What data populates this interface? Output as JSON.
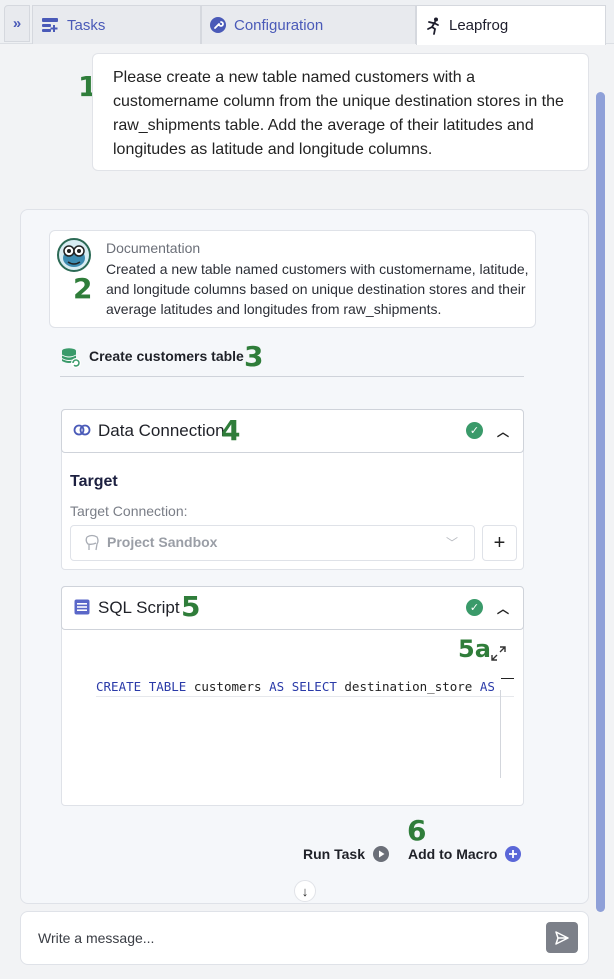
{
  "tabs": {
    "collapse_icon": "double-chevron-right-icon",
    "items": [
      {
        "label": "Tasks",
        "icon": "tasks-icon"
      },
      {
        "label": "Configuration",
        "icon": "wrench-icon"
      },
      {
        "label": "Leapfrog",
        "icon": "runner-icon",
        "active": true
      }
    ]
  },
  "annotations": {
    "a1": "1",
    "a2": "2",
    "a3": "3",
    "a4": "4",
    "a5": "5",
    "a5a": "5a",
    "a6": "6"
  },
  "prompt": {
    "text": "Please create a new table named customers with a customername column from the unique destination stores in the raw_shipments table. Add the average of their latitudes and longitudes as latitude and longitude columns."
  },
  "documentation": {
    "title": "Documentation",
    "text": "Created a new table named customers with customername, latitude, and longitude columns based on unique destination stores and their average latitudes and longitudes from raw_shipments."
  },
  "step": {
    "label": "Create customers table",
    "icon": "database-refresh-icon"
  },
  "data_connection": {
    "title": "Data Connection",
    "status": "success",
    "target_title": "Target",
    "target_label": "Target Connection:",
    "selected": "Project Sandbox",
    "add_label": "+"
  },
  "sql_script": {
    "title": "SQL Script",
    "status": "success",
    "code": {
      "k1": "CREATE",
      "k2": "TABLE",
      "t1": " customers ",
      "k3": "AS",
      "k4": "SELECT",
      "t2": " destination_store ",
      "k5": "AS"
    }
  },
  "actions": {
    "run_task": "Run Task",
    "add_to_macro": "Add to Macro"
  },
  "message": {
    "placeholder": "Write a message..."
  },
  "colors": {
    "accent": "#4a5ab8",
    "annotation": "#2f7d3a",
    "success": "#3a9a6a",
    "scrollbar": "#8fa0d8"
  }
}
